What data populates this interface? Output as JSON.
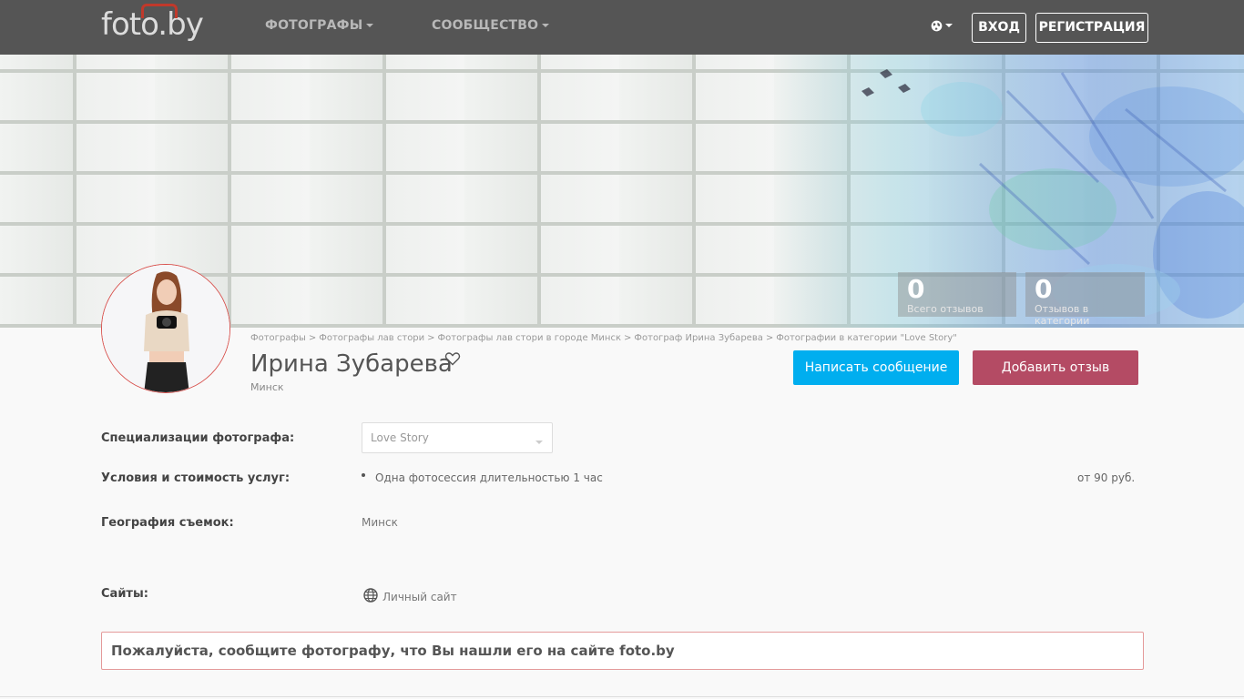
{
  "header": {
    "logo": "foto.by",
    "nav": [
      {
        "label": "ФОТОГРАФЫ"
      },
      {
        "label": "СООБЩЕСТВО"
      }
    ],
    "login": "ВХОД",
    "register": "РЕГИСТРАЦИЯ"
  },
  "stats": [
    {
      "value": "0",
      "label": "Всего отзывов"
    },
    {
      "value": "0",
      "label": "Отзывов в категории"
    }
  ],
  "breadcrumb": [
    "Фотографы",
    "Фотографы лав стори",
    "Фотографы лав стори в городе Минск",
    "Фотограф Ирина Зубарева",
    "Фотографии в категории \"Love Story\""
  ],
  "breadcrumb_sep": ">",
  "profile": {
    "name": "Ирина Зубарева",
    "city": "Минск"
  },
  "actions": {
    "message": "Написать сообщение",
    "review": "Добавить отзыв"
  },
  "details": {
    "specializations_label": "Специализации фотографа:",
    "specialization_selected": "Love Story",
    "services_label": "Условия и стоимость услуг:",
    "services": [
      {
        "name": "Одна фотосессия длительностью 1 час",
        "price": "от 90 руб."
      }
    ],
    "geography_label": "География съемок:",
    "geography": "Минск",
    "sites_label": "Сайты:",
    "site_link": "Личный сайт"
  },
  "notice": "Пожалуйста, сообщите фотографу, что Вы нашли его на сайте foto.by",
  "colors": {
    "topbar": "#555555",
    "message_button": "#00aeef",
    "review_button": "#b44b64",
    "notice_border": "#e49a9a"
  }
}
